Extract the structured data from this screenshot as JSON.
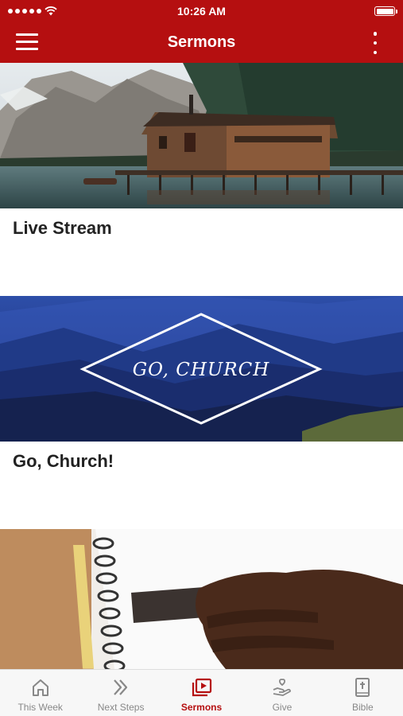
{
  "status_bar": {
    "time": "10:26 AM"
  },
  "header": {
    "title": "Sermons"
  },
  "cards": [
    {
      "title": "Live Stream"
    },
    {
      "title": "Go, Church!",
      "image_text": "GO, CHURCH"
    },
    {
      "title": ""
    }
  ],
  "tabs": [
    {
      "label": "This Week",
      "icon": "home-icon"
    },
    {
      "label": "Next Steps",
      "icon": "double-chevron-icon"
    },
    {
      "label": "Sermons",
      "icon": "video-library-icon"
    },
    {
      "label": "Give",
      "icon": "give-hand-icon"
    },
    {
      "label": "Bible",
      "icon": "bible-icon"
    }
  ],
  "colors": {
    "brand": "#b50f10",
    "tab_inactive": "#888888",
    "text": "#222222"
  },
  "active_tab": "Sermons"
}
